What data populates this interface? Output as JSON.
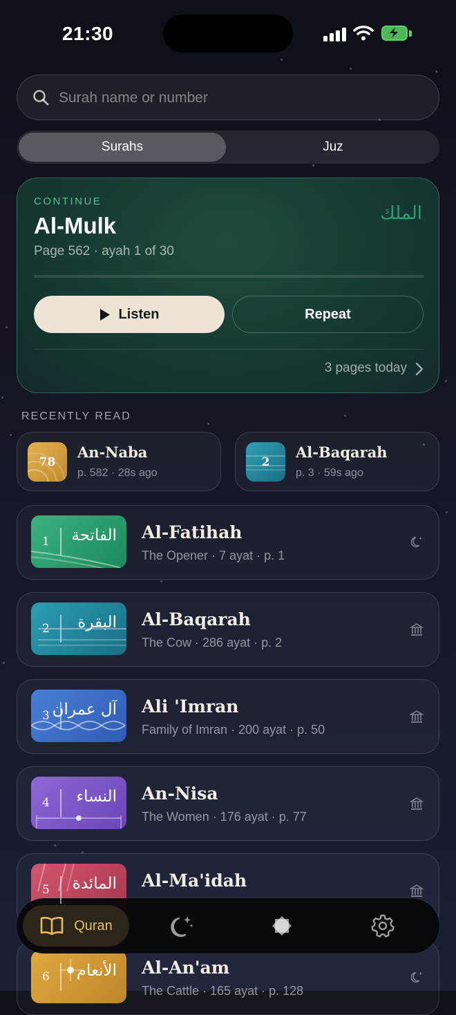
{
  "status_bar": {
    "time": "21:30"
  },
  "search": {
    "placeholder": "Surah name or number"
  },
  "tabs": {
    "surahs": "Surahs",
    "juz": "Juz",
    "selected": "Surahs"
  },
  "continue_card": {
    "label": "CONTINUE",
    "title": "Al-Mulk",
    "arabic": "الملك",
    "subtitle": "Page 562 · ayah 1 of 30",
    "progress": 0.0,
    "listen_label": "Listen",
    "repeat_label": "Repeat",
    "pages_today": "3 pages today"
  },
  "recent": {
    "label": "RECENTLY READ",
    "items": [
      {
        "number": "78",
        "title": "An-Naba",
        "subtitle": "p. 582 · 28s ago",
        "color": "#d9a441"
      },
      {
        "number": "2",
        "title": "Al-Baqarah",
        "subtitle": "p. 3 · 59s ago",
        "color": "#2a8da0"
      }
    ]
  },
  "surahs": [
    {
      "number": "1",
      "arabic": "الفاتحة",
      "title": "Al-Fatihah",
      "meaning": "The Opener",
      "ayat": "7 ayat",
      "page": "p. 1",
      "type_icon": "moon-star-icon"
    },
    {
      "number": "2",
      "arabic": "البقرة",
      "title": "Al-Baqarah",
      "meaning": "The Cow",
      "ayat": "286 ayat",
      "page": "p. 2",
      "type_icon": "mosque-icon"
    },
    {
      "number": "3",
      "arabic": "آل عمران",
      "title": "Ali 'Imran",
      "meaning": "Family of Imran",
      "ayat": "200 ayat",
      "page": "p. 50",
      "type_icon": "mosque-icon"
    },
    {
      "number": "4",
      "arabic": "النساء",
      "title": "An-Nisa",
      "meaning": "The Women",
      "ayat": "176 ayat",
      "page": "p. 77",
      "type_icon": "mosque-icon"
    },
    {
      "number": "5",
      "arabic": "المائدة",
      "title": "Al-Ma'idah",
      "meaning": "",
      "ayat": "",
      "page": "",
      "type_icon": "mosque-icon"
    },
    {
      "number": "6",
      "arabic": "الأنعام",
      "title": "Al-An'am",
      "meaning": "The Cattle",
      "ayat": "165 ayat",
      "page": "p. 128",
      "type_icon": "moon-star-icon"
    }
  ],
  "tabbar": {
    "quran_label": "Quran",
    "accent": "#e7bf62"
  },
  "colors": {
    "accent_green": "#5fbf8e",
    "arabic_green": "#2f9d72"
  }
}
